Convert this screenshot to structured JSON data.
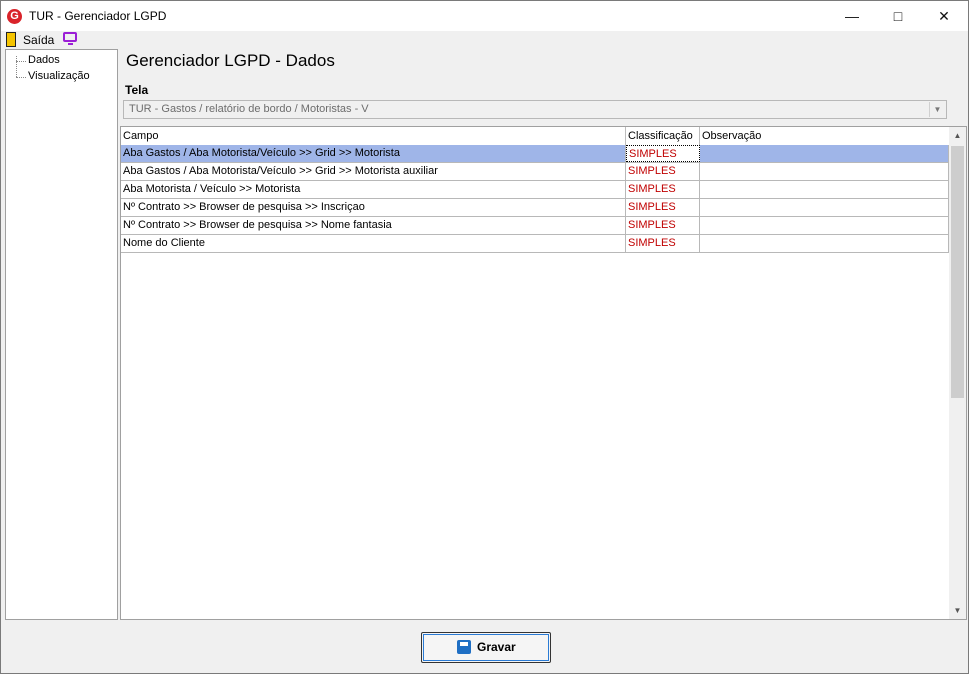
{
  "window": {
    "app_icon": "G",
    "title": "TUR - Gerenciador LGPD"
  },
  "menu": {
    "exit_label": "Saída"
  },
  "tree": {
    "items": [
      "Dados",
      "Visualização"
    ]
  },
  "page": {
    "title": "Gerenciador LGPD - Dados",
    "tela_label": "Tela"
  },
  "combo": {
    "value": "TUR - Gastos / relatório de bordo / Motoristas - V"
  },
  "grid": {
    "columns": [
      "Campo",
      "Classificação",
      "Observação"
    ],
    "rows": [
      {
        "campo": "Aba Gastos / Aba  Motorista/Veículo >> Grid >> Motorista",
        "classificacao": "SIMPLES",
        "observacao": ""
      },
      {
        "campo": "Aba Gastos / Aba  Motorista/Veículo >> Grid >> Motorista auxiliar",
        "classificacao": "SIMPLES",
        "observacao": ""
      },
      {
        "campo": "Aba Motorista / Veículo >> Motorista",
        "classificacao": "SIMPLES",
        "observacao": ""
      },
      {
        "campo": "Nº Contrato >> Browser de pesquisa >> Inscriçao",
        "classificacao": "SIMPLES",
        "observacao": ""
      },
      {
        "campo": "Nº Contrato >> Browser de pesquisa >> Nome fantasia",
        "classificacao": "SIMPLES",
        "observacao": ""
      },
      {
        "campo": "Nome do Cliente",
        "classificacao": "SIMPLES",
        "observacao": ""
      }
    ]
  },
  "footer": {
    "save_label": "Gravar"
  },
  "colors": {
    "selection": "#9fb5e8",
    "classification_text": "#c00000"
  }
}
